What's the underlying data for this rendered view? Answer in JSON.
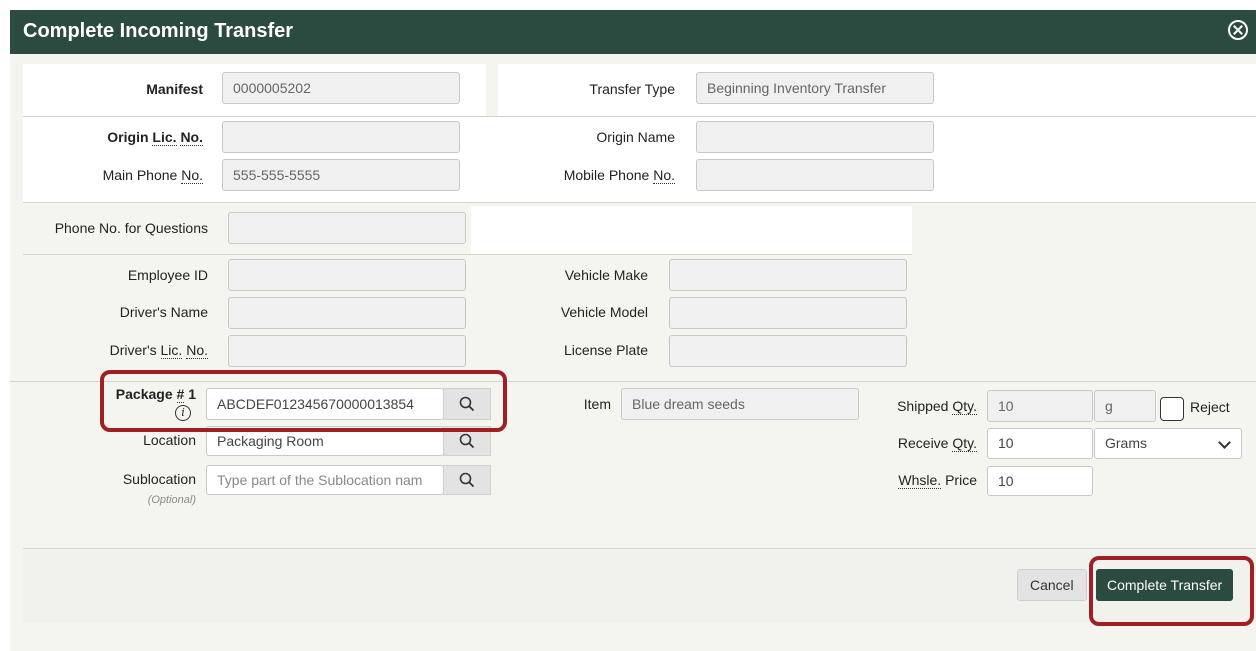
{
  "modal": {
    "title": "Complete Incoming Transfer"
  },
  "manifest": {
    "label": "Manifest",
    "value": "0000005202",
    "transfer_type_label": "Transfer Type",
    "transfer_type_value": "Beginning Inventory Transfer"
  },
  "origin": {
    "lic_label_prefix": "Origin ",
    "lic_label_abbr": "Lic.",
    "lic_label_mid": " ",
    "lic_label_abbr2": "No.",
    "lic_value": "",
    "name_label": "Origin Name",
    "name_value": "",
    "main_phone_label_prefix": "Main Phone ",
    "main_phone_label_abbr": "No.",
    "main_phone_value": "555-555-5555",
    "mobile_phone_label_prefix": "Mobile Phone ",
    "mobile_phone_label_abbr": "No.",
    "mobile_phone_value": ""
  },
  "transport": {
    "phone_questions_label": "Phone No. for Questions",
    "phone_questions_value": "",
    "employee_id_label": "Employee ID",
    "employee_id_value": "",
    "drivers_name_label": "Driver's Name",
    "drivers_name_value": "",
    "drivers_lic_label_prefix": "Driver's ",
    "drivers_lic_label_abbr": "Lic.",
    "drivers_lic_label_mid": " ",
    "drivers_lic_label_abbr2": "No.",
    "drivers_lic_value": "",
    "vehicle_make_label": "Vehicle Make",
    "vehicle_make_value": "",
    "vehicle_model_label": "Vehicle Model",
    "vehicle_model_value": "",
    "license_plate_label": "License Plate",
    "license_plate_value": ""
  },
  "package": {
    "label_prefix": "Package ",
    "label_abbr": "#",
    "label_suffix": " 1",
    "value": "ABCDEF012345670000013854",
    "info_icon_glyph": "i",
    "location_label": "Location",
    "location_value": "Packaging Room",
    "sublocation_label": "Sublocation",
    "sublocation_optional": "(Optional)",
    "sublocation_placeholder": "Type part of the Sublocation nam",
    "item_label": "Item",
    "item_value": "Blue dream seeds",
    "shipped_qty_label_prefix": "Shipped ",
    "shipped_qty_label_abbr": "Qty.",
    "shipped_qty_value": "10",
    "shipped_unit": "g",
    "reject_label": "Reject",
    "reject_checked": false,
    "receive_qty_label_prefix": "Receive ",
    "receive_qty_label_abbr": "Qty.",
    "receive_qty_value": "10",
    "receive_unit_selected": "Grams",
    "whsle_price_label_abbr": "Whsle.",
    "whsle_price_label_suffix": " Price",
    "whsle_price_value": "10"
  },
  "footer": {
    "cancel_label": "Cancel",
    "complete_label": "Complete Transfer"
  },
  "colors": {
    "header_bg": "#2b4b41",
    "highlight": "#a01f22",
    "primary_button": "#2b4b41"
  },
  "icons": {
    "search": "search-icon",
    "close": "close-circle-icon",
    "info": "info-icon",
    "dropdown": "chevron-down-icon"
  }
}
